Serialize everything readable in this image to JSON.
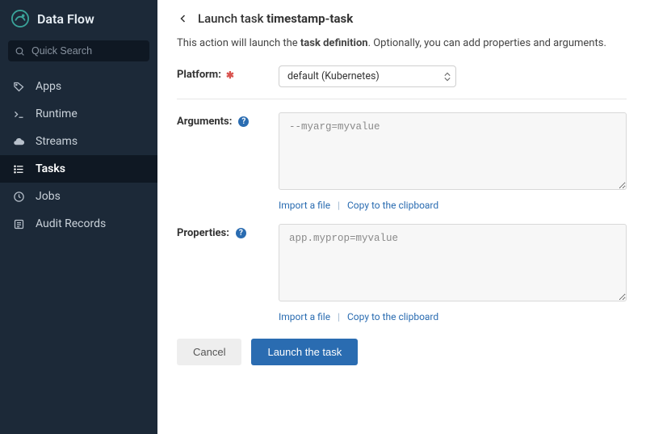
{
  "brand": {
    "title": "Data Flow"
  },
  "search": {
    "placeholder": "Quick Search"
  },
  "sidebar": {
    "items": [
      {
        "label": "Apps"
      },
      {
        "label": "Runtime"
      },
      {
        "label": "Streams"
      },
      {
        "label": "Tasks"
      },
      {
        "label": "Jobs"
      },
      {
        "label": "Audit Records"
      }
    ]
  },
  "page": {
    "title_prefix": "Launch task ",
    "title_task": "timestamp-task",
    "intro_pre": "This action will launch the ",
    "intro_bold": "task definition",
    "intro_post": ". Optionally, you can add properties and arguments."
  },
  "form": {
    "platform_label": "Platform:",
    "platform_value": "default (Kubernetes)",
    "arguments_label": "Arguments:",
    "arguments_placeholder": "--myarg=myvalue",
    "properties_label": "Properties:",
    "properties_placeholder": "app.myprop=myvalue",
    "import_label": "Import a file",
    "copy_label": "Copy to the clipboard"
  },
  "buttons": {
    "cancel": "Cancel",
    "launch": "Launch the task"
  }
}
